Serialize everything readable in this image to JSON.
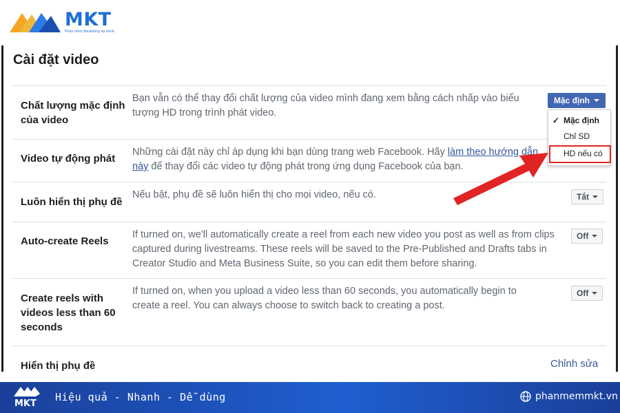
{
  "brand": {
    "name": "MKT",
    "tagline": "Phần mềm Marketing đa kênh"
  },
  "settings": {
    "title": "Cài đặt video",
    "rows": [
      {
        "label": "Chất lượng mặc định của video",
        "description": "Bạn vẫn có thể thay đổi chất lượng của video mình đang xem bằng cách nhấp vào biểu tượng HD trong trình phát video.",
        "control": "Mặc định"
      },
      {
        "label": "Video tự động phát",
        "description_before": "Những cài đặt này chỉ áp dụng khi bạn dùng trang web Facebook. Hãy ",
        "description_link": "làm theo hướng dẫn này",
        "description_after": " để thay đổi các video tự động phát trong ứng dụng Facebook của bạn."
      },
      {
        "label": "Luôn hiển thị phụ đề",
        "description": "Nếu bật, phụ đề sẽ luôn hiển thị cho mọi video, nếu có.",
        "control": "Tắt"
      },
      {
        "label": "Auto-create Reels",
        "description": "If turned on, we'll automatically create a reel from each new video you post as well as from clips captured during livestreams. These reels will be saved to the Pre-Published and Drafts tabs in Creator Studio and Meta Business Suite, so you can edit them before sharing.",
        "control": "Off"
      },
      {
        "label": "Create reels with videos less than 60 seconds",
        "description": "If turned on, when you upload a video less than 60 seconds, you automatically begin to create a reel. You can always choose to switch back to creating a post.",
        "control": "Off"
      },
      {
        "label": "Hiển thị phụ đề",
        "action": "Chỉnh sửa"
      }
    ],
    "quality_menu": {
      "options": [
        "Mặc định",
        "Chỉ SD",
        "HD nếu có"
      ],
      "selected": "Mặc định",
      "highlighted": "HD nếu có"
    }
  },
  "footer": {
    "slogan": "Hiệu quả - Nhanh  - Dễ dùng",
    "website": "phanmemmkt.vn"
  },
  "colors": {
    "brand_blue": "#1f6fd6",
    "facebook_blue": "#4267b2",
    "highlight_red": "#e02424"
  },
  "icons": [
    "mkt-logo-icon",
    "checkmark-icon",
    "caret-down-icon",
    "red-arrow-icon",
    "globe-icon"
  ]
}
